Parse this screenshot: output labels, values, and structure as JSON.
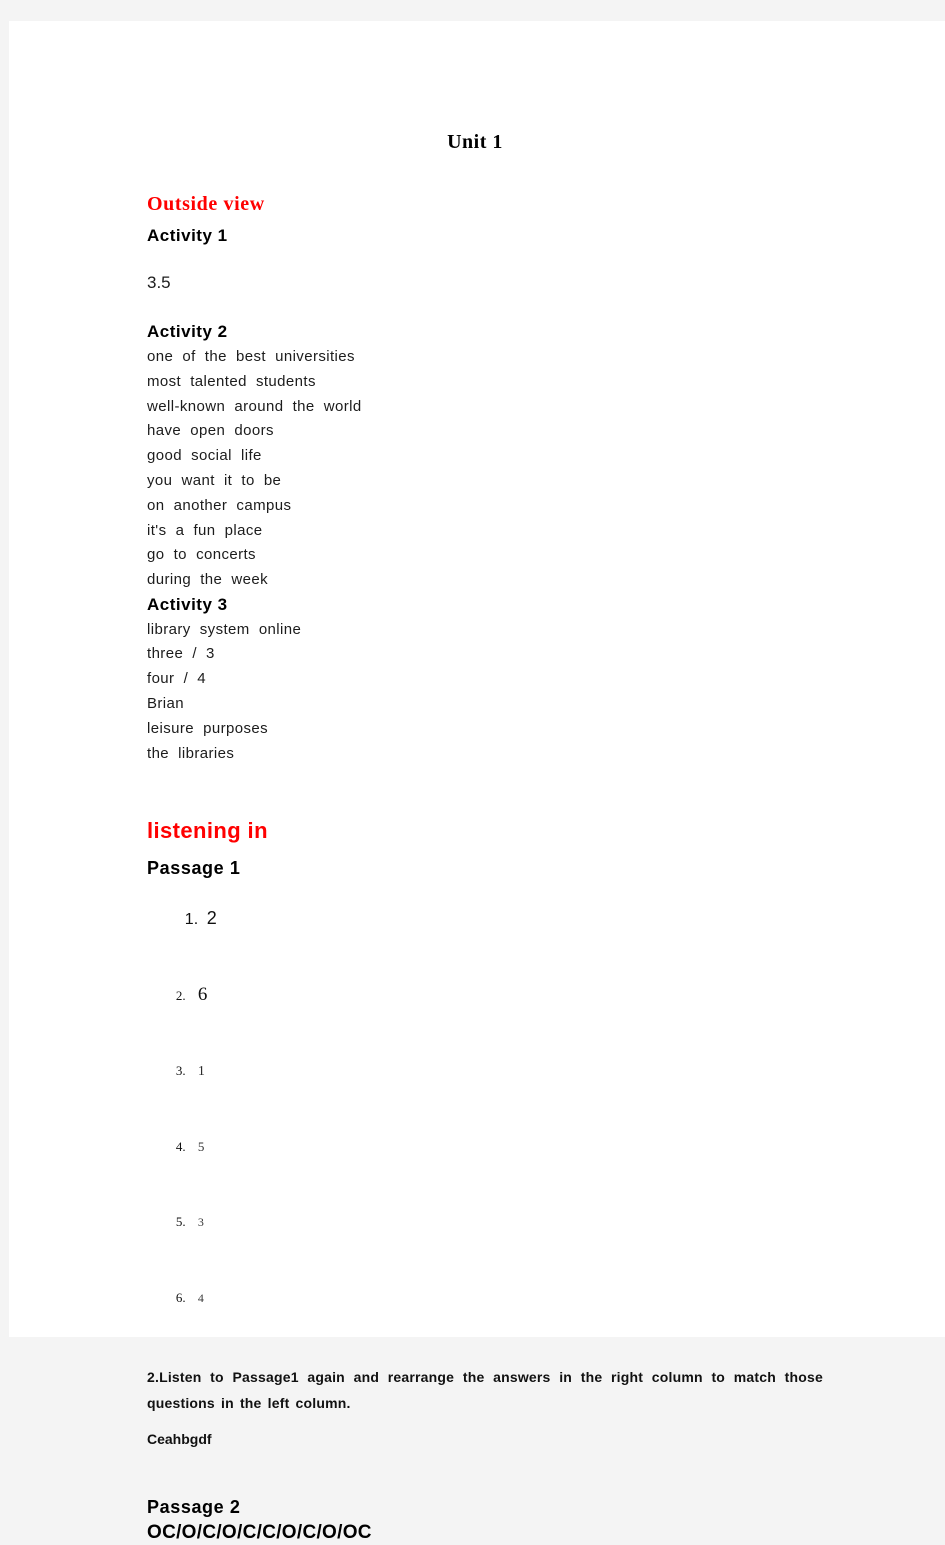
{
  "page": {
    "background_color": "#f4f4f4",
    "sheet_color": "#ffffff",
    "accent_color": "#ff0000",
    "text_color": "#1c1c1c"
  },
  "document": {
    "title": "Unit  1"
  },
  "sections": [
    {
      "heading": "Outside  view",
      "heading_style": "red-serif",
      "activities": [
        {
          "heading": "Activity  1",
          "answers": [
            "3.5"
          ]
        },
        {
          "heading": "Activity  2",
          "answers": [
            "one  of  the  best  universities",
            "most  talented  students",
            "well-known  around  the  world",
            "have  open  doors",
            "good  social  life",
            "you  want  it  to  be",
            "on  another  campus",
            "it's  a  fun  place",
            "go  to  concerts",
            "during  the  week"
          ]
        },
        {
          "heading": "Activity  3",
          "answers": [
            "library  system  online",
            "three  /  3",
            "four  /  4",
            "Brian",
            "leisure  purposes",
            "the  libraries"
          ]
        }
      ]
    },
    {
      "heading": "listening  in",
      "heading_style": "red-sans",
      "passages": [
        {
          "heading": "Passage  1",
          "numbered_answers": [
            {
              "number": "1.",
              "value": "2"
            },
            {
              "number": "2.",
              "value": "6"
            },
            {
              "number": "3.",
              "value": "1"
            },
            {
              "number": "4.",
              "value": "5"
            },
            {
              "number": "5.",
              "value": "3"
            },
            {
              "number": "6.",
              "value": "4"
            }
          ],
          "instruction": "2.Listen to Passage1 again and rearrange the answers in the right column to match those questions in the left column.",
          "match_key": "Ceahbgdf"
        },
        {
          "heading": "Passage  2",
          "answer_string": "OC/O/C/O/C/C/O/C/O/OC"
        }
      ]
    }
  ]
}
